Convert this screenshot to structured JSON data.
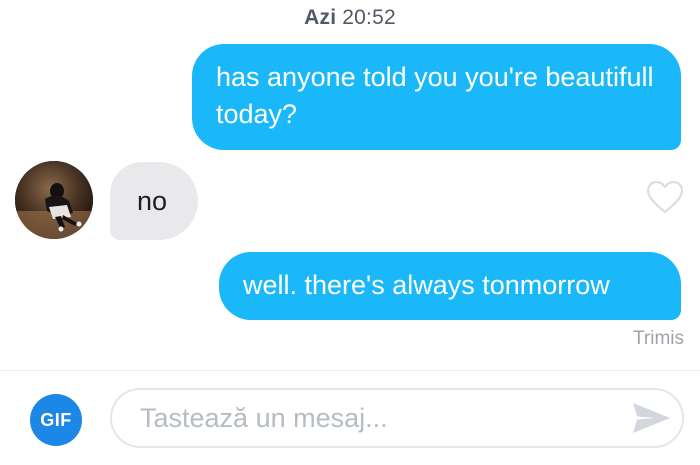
{
  "header": {
    "day": "Azi",
    "time": "20:52"
  },
  "messages": [
    {
      "direction": "sent",
      "text": "has anyone told you you're beautifull today?"
    },
    {
      "direction": "received",
      "text": "no",
      "liked": false
    },
    {
      "direction": "sent",
      "text": "well. there's always tonmorrow"
    }
  ],
  "status": "Trimis",
  "composer": {
    "gif_label": "GIF",
    "placeholder": "Tastează un mesaj...",
    "value": ""
  },
  "icons": {
    "heart": "heart-outline-icon",
    "send": "paper-plane-send-icon",
    "avatar": "contact-avatar-photo"
  },
  "colors": {
    "sent_bubble": "#1ab8f8",
    "received_bubble": "#e9e9eb",
    "gif_button": "#1d87e6",
    "muted_text": "#9ca3ad"
  }
}
